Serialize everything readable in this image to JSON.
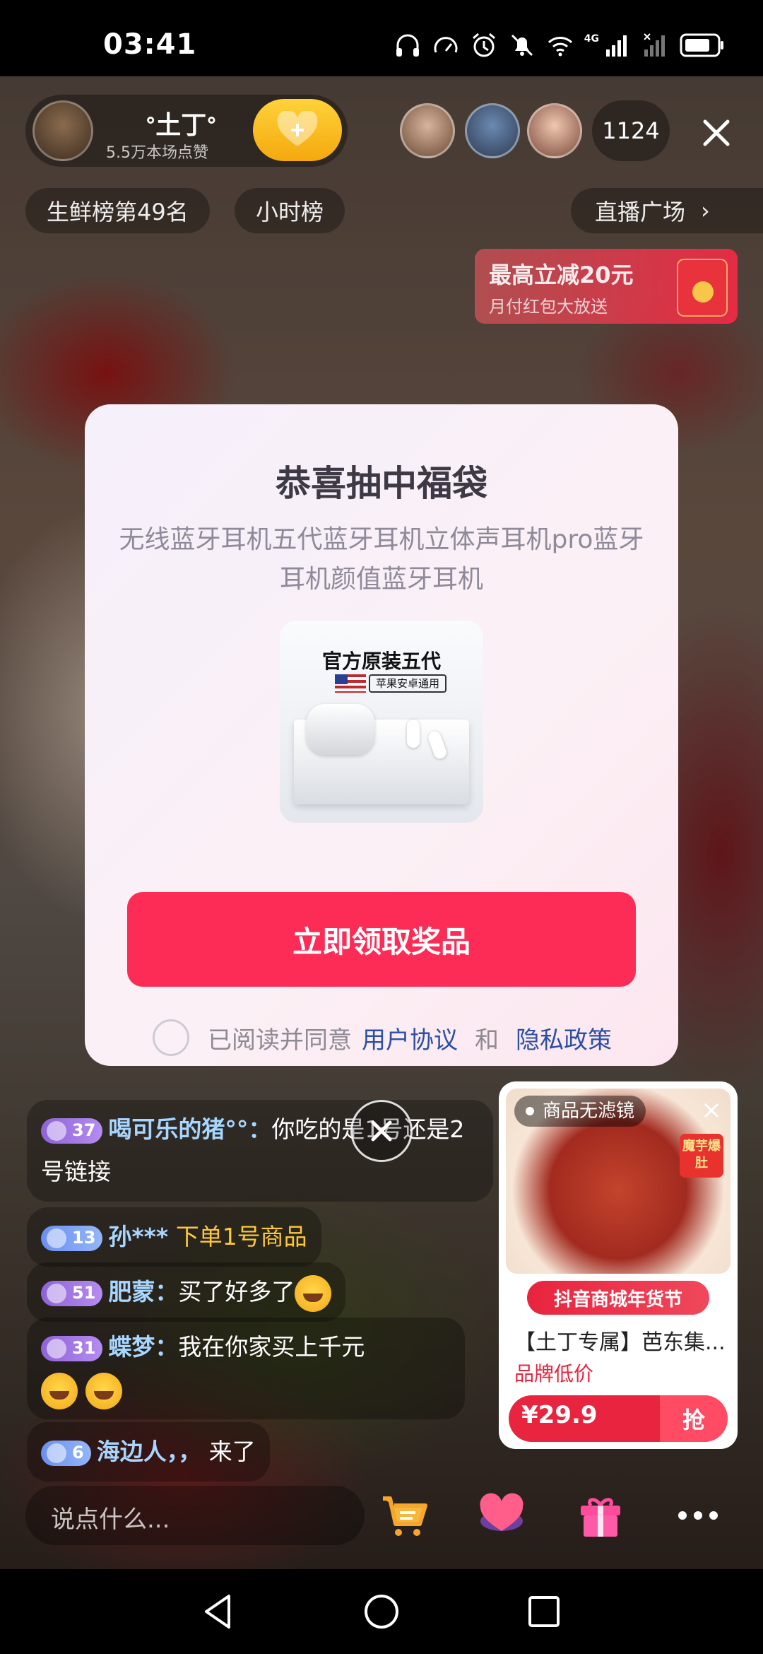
{
  "status_bar": {
    "time": "03:41",
    "network": "4G",
    "icons": [
      "headphones-icon",
      "speed-icon",
      "alarm-icon",
      "mute-icon",
      "wifi-icon",
      "signal-icon",
      "signal-2-icon",
      "battery-icon"
    ]
  },
  "host": {
    "name": "ᐤ土丁ᐤ",
    "likes": "5.5万本场点赞",
    "viewer_count": "1124"
  },
  "chips": {
    "rank": "生鲜榜第49名",
    "hour": "小时榜",
    "plaza": "直播广场",
    "plaza_arrow": "›"
  },
  "promo": {
    "title": "最高立减20元",
    "subtitle": "月付红包大放送"
  },
  "modal": {
    "title": "恭喜抽中福袋",
    "description": "无线蓝牙耳机五代蓝牙耳机立体声耳机pro蓝牙耳机颜值蓝牙耳机",
    "prize_label": "官方原装五代",
    "prize_tag": "苹果安卓通用",
    "claim_button": "立即领取奖品",
    "agree_text": "已阅读并同意",
    "user_agreement": "用户协议",
    "and": "和",
    "privacy_policy": "隐私政策"
  },
  "chat": [
    {
      "level": "37",
      "user": "喝可乐的猪°°",
      "separator": "：",
      "text": "你吃的是1号还是2号链接"
    },
    {
      "level": "13",
      "user": "孙***",
      "separator": "",
      "text": "下单1号商品"
    },
    {
      "level": "51",
      "user": "肥蒙",
      "separator": "：",
      "text": "买了好多了"
    },
    {
      "level": "31",
      "user": "蝶梦",
      "separator": "：",
      "text": "我在你家买上千元"
    },
    {
      "level": "6",
      "user": "海边人，，",
      "separator": "",
      "text": "来了"
    }
  ],
  "product": {
    "badge": "商品无滤镜",
    "hot_tag": "魔芋爆肚",
    "banner": "抖音商城年货节",
    "name": "【土丁专属】芭东集...",
    "subtitle": "品牌低价",
    "price": "¥29.9",
    "buy_label": "抢"
  },
  "input": {
    "placeholder": "说点什么..."
  },
  "colors": {
    "claim_button": "#fd2c56",
    "link": "#2c4fa6",
    "accent_red": "#e8243e",
    "gold": "#ffc83a"
  }
}
